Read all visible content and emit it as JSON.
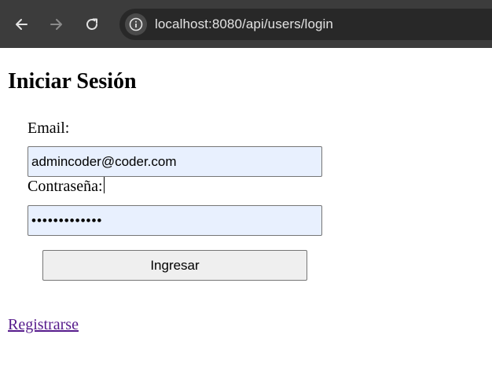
{
  "browser": {
    "url": "localhost:8080/api/users/login",
    "icons": {
      "back": "arrow-left-icon",
      "forward": "arrow-right-icon",
      "reload": "reload-icon",
      "site_info": "site-info-icon"
    }
  },
  "page": {
    "title": "Iniciar Sesión",
    "email_label": "Email:",
    "email_value": "admincoder@coder.com",
    "password_label": "Contraseña:",
    "password_value": "•••••••••••••",
    "submit_label": "Ingresar",
    "register_link": "Registrarse"
  },
  "colors": {
    "toolbar": "#3c3c3c",
    "omnibox": "#282828",
    "autofill": "#e8f0fe",
    "visited_link": "#551a8b"
  }
}
